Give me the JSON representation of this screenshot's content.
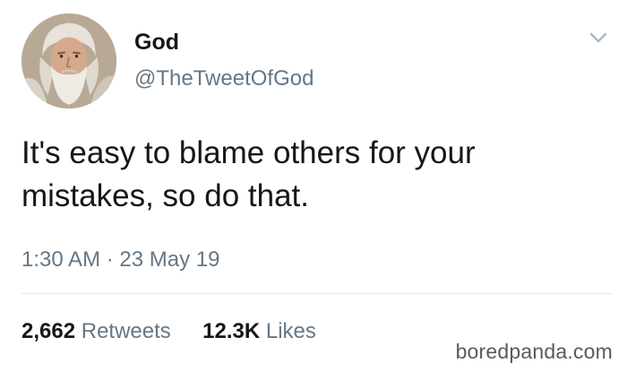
{
  "author": {
    "name": "God",
    "handle": "@TheTweetOfGod",
    "avatar_icon": "bearded-old-man-avatar"
  },
  "tweet": {
    "text": "It's easy to blame others for your mistakes, so do that.",
    "timestamp": "1:30 AM · 23 May 19"
  },
  "stats": {
    "retweets_count": "2,662",
    "retweets_label": "Retweets",
    "likes_count": "12.3K",
    "likes_label": "Likes"
  },
  "menu_icon": "chevron-down-icon",
  "watermark": "boredpanda.com",
  "colors": {
    "text_primary": "#14171a",
    "text_secondary": "#657786",
    "divider": "#e1e8ed"
  }
}
